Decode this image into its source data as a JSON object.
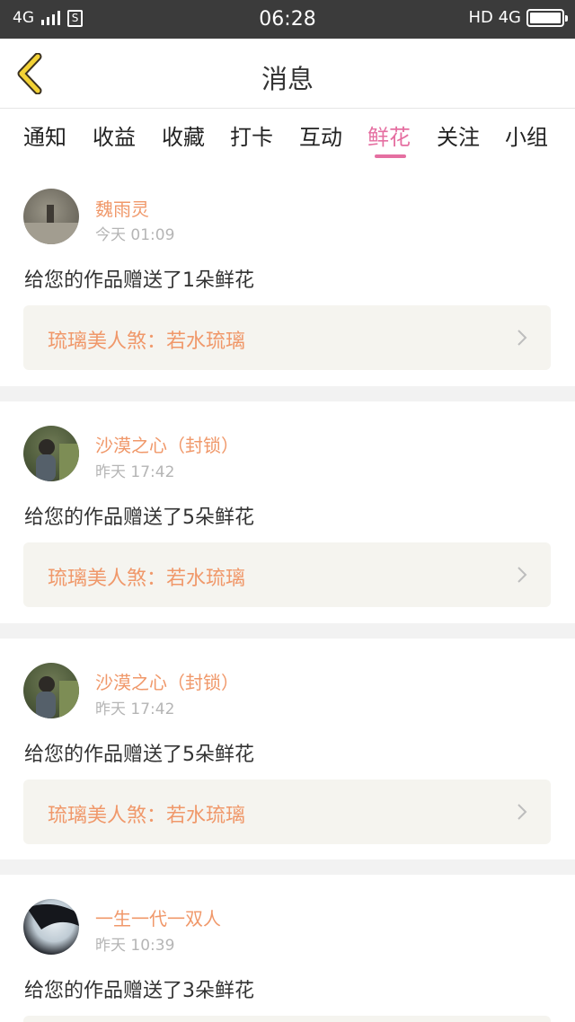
{
  "status_bar": {
    "network": "4G",
    "sim_label": "S",
    "time": "06:28",
    "right_label": "HD 4G"
  },
  "header": {
    "title": "消息"
  },
  "tabs": [
    {
      "label": "通知"
    },
    {
      "label": "收益"
    },
    {
      "label": "收藏"
    },
    {
      "label": "打卡"
    },
    {
      "label": "互动"
    },
    {
      "label": "鲜花",
      "active": true
    },
    {
      "label": "关注"
    },
    {
      "label": "小组"
    }
  ],
  "messages": [
    {
      "user": "魏雨灵",
      "time": "今天 01:09",
      "text": "给您的作品赠送了1朵鲜花",
      "work": "琉璃美人煞：若水琉璃"
    },
    {
      "user": "沙漠之心（封锁）",
      "time": "昨天 17:42",
      "text": "给您的作品赠送了5朵鲜花",
      "work": "琉璃美人煞：若水琉璃"
    },
    {
      "user": "沙漠之心（封锁）",
      "time": "昨天 17:42",
      "text": "给您的作品赠送了5朵鲜花",
      "work": "琉璃美人煞：若水琉璃"
    },
    {
      "user": "一生一代一双人",
      "time": "昨天 10:39",
      "text": "给您的作品赠送了3朵鲜花",
      "work": ""
    }
  ],
  "colors": {
    "accent_pink": "#e56fa1",
    "name_orange": "#f0986a",
    "back_arrow_yellow": "#f3d235"
  }
}
